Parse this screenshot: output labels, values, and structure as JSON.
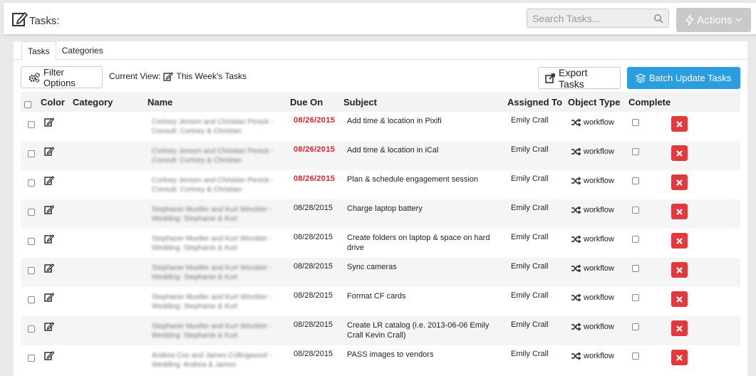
{
  "header": {
    "title": "Tasks:",
    "search_placeholder": "Search Tasks...",
    "actions_label": "Actions"
  },
  "tabs": [
    {
      "label": "Tasks",
      "active": true
    },
    {
      "label": "Categories",
      "active": false
    }
  ],
  "toolbar": {
    "filter_label": "Filter Options",
    "current_view_label": "Current View:",
    "current_view_value": "This Week's Tasks",
    "export_label": "Export Tasks",
    "batch_label": "Batch Update Tasks",
    "batch_color": "#2b9ee0"
  },
  "table": {
    "columns": [
      "Color",
      "Category",
      "Name",
      "Due On",
      "Subject",
      "Assigned To",
      "Object Type",
      "Complete"
    ],
    "rows": [
      {
        "name": "Cortney Jensen and Christian Penick - Consult: Cortney & Christian",
        "due": "08/26/2015",
        "overdue": true,
        "subject": "Add time & location in Pixifi",
        "assigned": "Emily Crall",
        "type": "workflow"
      },
      {
        "name": "Cortney Jensen and Christian Penick - Consult: Cortney & Christian",
        "due": "08/26/2015",
        "overdue": true,
        "subject": "Add time & location in iCal",
        "assigned": "Emily Crall",
        "type": "workflow"
      },
      {
        "name": "Cortney Jensen and Christian Penick - Consult: Cortney & Christian",
        "due": "08/26/2015",
        "overdue": true,
        "subject": "Plan & schedule engagement session",
        "assigned": "Emily Crall",
        "type": "workflow"
      },
      {
        "name": "Stephanie Mueller and Kurt Winckler - Wedding: Stephanie & Kurt",
        "due": "08/28/2015",
        "overdue": false,
        "subject": "Charge laptop battery",
        "assigned": "Emily Crall",
        "type": "workflow"
      },
      {
        "name": "Stephanie Mueller and Kurt Winckler - Wedding: Stephanie & Kurt",
        "due": "08/28/2015",
        "overdue": false,
        "subject": "Create folders on laptop & space on hard drive",
        "assigned": "Emily Crall",
        "type": "workflow"
      },
      {
        "name": "Stephanie Mueller and Kurt Winckler - Wedding: Stephanie & Kurt",
        "due": "08/28/2015",
        "overdue": false,
        "subject": "Sync cameras",
        "assigned": "Emily Crall",
        "type": "workflow"
      },
      {
        "name": "Stephanie Mueller and Kurt Winckler - Wedding: Stephanie & Kurt",
        "due": "08/28/2015",
        "overdue": false,
        "subject": "Format CF cards",
        "assigned": "Emily Crall",
        "type": "workflow"
      },
      {
        "name": "Stephanie Mueller and Kurt Winckler - Wedding: Stephanie & Kurt",
        "due": "08/28/2015",
        "overdue": false,
        "subject": "Create LR catalog (i.e. 2013-06-06 Emily Crall Kevin Crall)",
        "assigned": "Emily Crall",
        "type": "workflow"
      },
      {
        "name": "Andrea Cox and James Collingwood - Wedding: Andrea & James",
        "due": "08/28/2015",
        "overdue": false,
        "subject": "PASS images to vendors",
        "assigned": "Emily Crall",
        "type": "workflow"
      }
    ]
  },
  "colors": {
    "overdue": "#e0202a",
    "delete": "#e0393e"
  }
}
